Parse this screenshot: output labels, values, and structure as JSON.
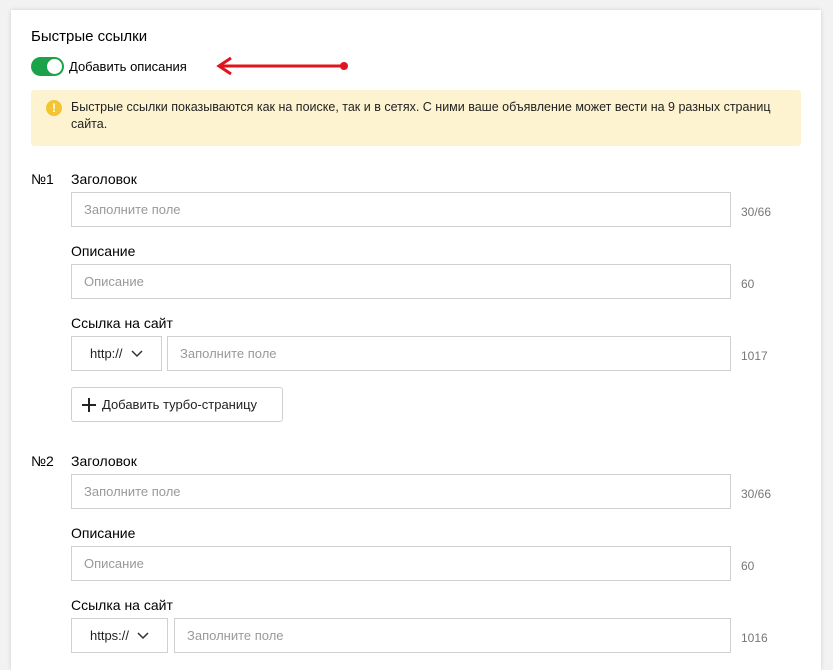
{
  "title": "Быстрые ссылки",
  "toggle": {
    "label": "Добавить описания",
    "on": true
  },
  "notice": {
    "icon": "warning-icon",
    "text": "Быстрые ссылки показываются как на поиске, так и в сетях. С ними ваше объявление может вести на 9 разных страниц сайта."
  },
  "links": [
    {
      "number": "№1",
      "title_label": "Заголовок",
      "title_placeholder": "Заполните поле",
      "title_counter": "30/66",
      "desc_label": "Описание",
      "desc_placeholder": "Описание",
      "desc_counter": "60",
      "url_label": "Ссылка на сайт",
      "protocol": "http://",
      "url_placeholder": "Заполните поле",
      "url_counter": "1017",
      "turbo_button": "Добавить турбо-страницу"
    },
    {
      "number": "№2",
      "title_label": "Заголовок",
      "title_placeholder": "Заполните поле",
      "title_counter": "30/66",
      "desc_label": "Описание",
      "desc_placeholder": "Описание",
      "desc_counter": "60",
      "url_label": "Ссылка на сайт",
      "protocol": "https://",
      "url_placeholder": "Заполните поле",
      "url_counter": "1016"
    }
  ],
  "colors": {
    "toggle_on": "#1aa34a",
    "notice_bg": "#fdf3d0",
    "notice_icon": "#f5c431",
    "arrow": "#e0141e"
  }
}
